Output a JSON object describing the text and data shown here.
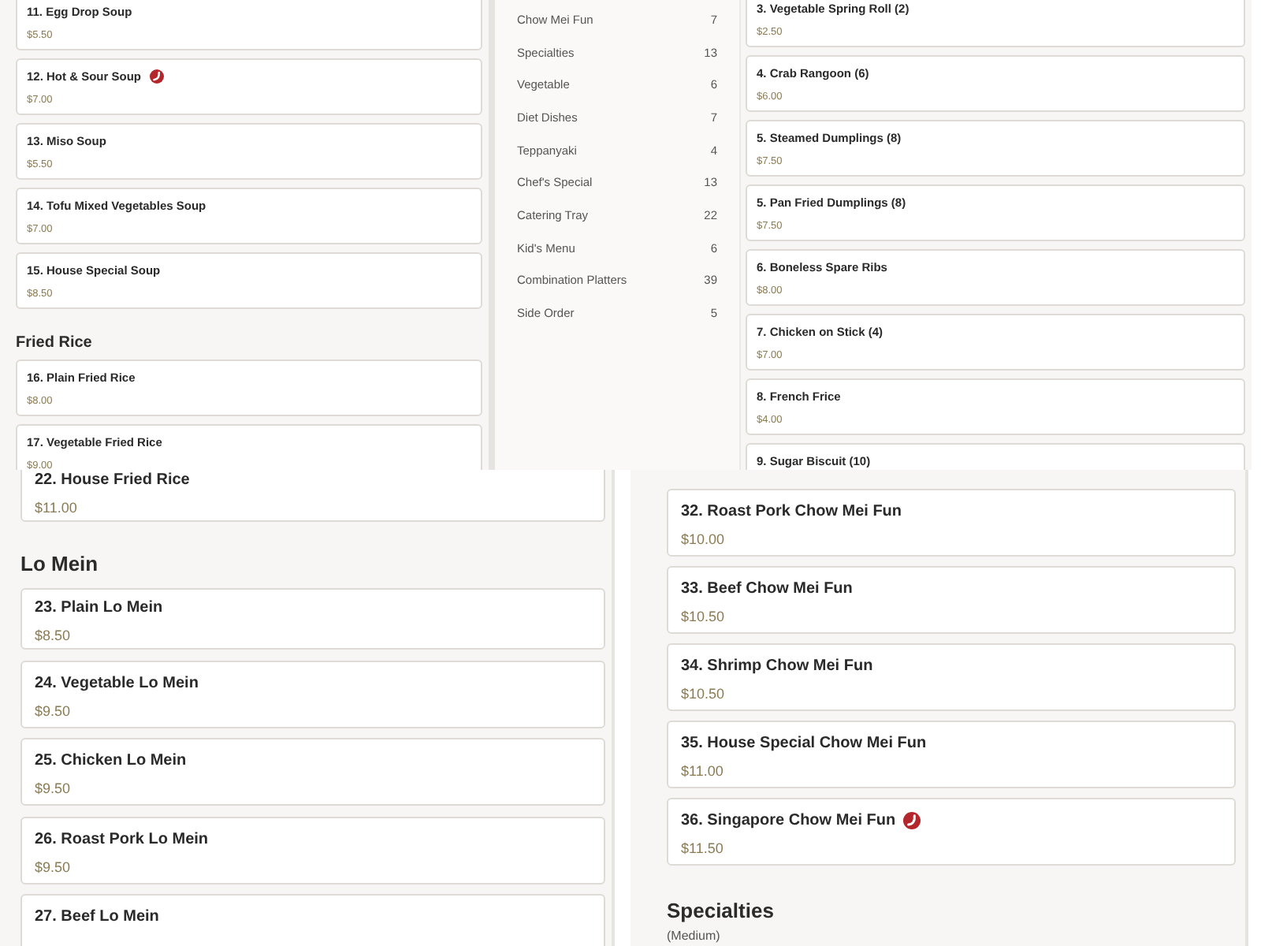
{
  "screens": [
    {
      "sections": [
        {
          "items": [
            {
              "name": "11. Egg Drop Soup",
              "price": "$5.50",
              "spicy": false
            },
            {
              "name": "12. Hot & Sour Soup",
              "price": "$7.00",
              "spicy": true
            },
            {
              "name": "13. Miso Soup",
              "price": "$5.50",
              "spicy": false
            },
            {
              "name": "14. Tofu Mixed Vegetables Soup",
              "price": "$7.00",
              "spicy": false
            },
            {
              "name": "15. House Special Soup",
              "price": "$8.50",
              "spicy": false
            }
          ]
        },
        {
          "title": "Fried Rice",
          "items": [
            {
              "name": "16. Plain Fried Rice",
              "price": "$8.00",
              "spicy": false
            },
            {
              "name": "17. Vegetable Fried Rice",
              "price": "$9.00",
              "spicy": false
            }
          ]
        }
      ]
    },
    {
      "categories": [
        {
          "name": "Chow Mei Fun",
          "count": "7"
        },
        {
          "name": "Specialties",
          "count": "13"
        },
        {
          "name": "Vegetable",
          "count": "6"
        },
        {
          "name": "Diet Dishes",
          "count": "7"
        },
        {
          "name": "Teppanyaki",
          "count": "4"
        },
        {
          "name": "Chef's Special",
          "count": "13"
        },
        {
          "name": "Catering Tray",
          "count": "22"
        },
        {
          "name": "Kid's Menu",
          "count": "6"
        },
        {
          "name": "Combination Platters",
          "count": "39"
        },
        {
          "name": "Side Order",
          "count": "5"
        }
      ],
      "sections": [
        {
          "items": [
            {
              "name": "3. Vegetable Spring Roll (2)",
              "price": "$2.50",
              "spicy": false
            },
            {
              "name": "4. Crab Rangoon (6)",
              "price": "$6.00",
              "spicy": false
            },
            {
              "name": "5. Steamed Dumplings (8)",
              "price": "$7.50",
              "spicy": false
            },
            {
              "name": "5. Pan Fried Dumplings (8)",
              "price": "$7.50",
              "spicy": false
            },
            {
              "name": "6. Boneless Spare Ribs",
              "price": "$8.00",
              "spicy": false
            },
            {
              "name": "7. Chicken on Stick (4)",
              "price": "$7.00",
              "spicy": false
            },
            {
              "name": "8. French Frice",
              "price": "$4.00",
              "spicy": false
            },
            {
              "name": "9. Sugar Biscuit (10)",
              "spicy": false
            }
          ]
        }
      ]
    },
    {
      "sections": [
        {
          "items": [
            {
              "name": "22. House Fried Rice",
              "price": "$11.00",
              "spicy": false
            }
          ]
        },
        {
          "title": "Lo Mein",
          "items": [
            {
              "name": "23. Plain Lo Mein",
              "price": "$8.50",
              "spicy": false
            },
            {
              "name": "24. Vegetable Lo Mein",
              "price": "$9.50",
              "spicy": false
            },
            {
              "name": "25. Chicken Lo Mein",
              "price": "$9.50",
              "spicy": false
            },
            {
              "name": "26. Roast Pork Lo Mein",
              "price": "$9.50",
              "spicy": false
            },
            {
              "name": "27. Beef Lo Mein",
              "spicy": false
            }
          ]
        }
      ]
    },
    {
      "sections": [
        {
          "items": [
            {
              "name": "32. Roast Pork Chow Mei Fun",
              "price": "$10.00",
              "spicy": false
            },
            {
              "name": "33. Beef Chow Mei Fun",
              "price": "$10.50",
              "spicy": false
            },
            {
              "name": "34. Shrimp Chow Mei Fun",
              "price": "$10.50",
              "spicy": false
            },
            {
              "name": "35. House Special Chow Mei Fun",
              "price": "$11.00",
              "spicy": false
            },
            {
              "name": "36. Singapore Chow Mei Fun",
              "price": "$11.50",
              "spicy": true
            }
          ]
        },
        {
          "title": "Specialties",
          "note": "(Medium)"
        }
      ]
    }
  ]
}
